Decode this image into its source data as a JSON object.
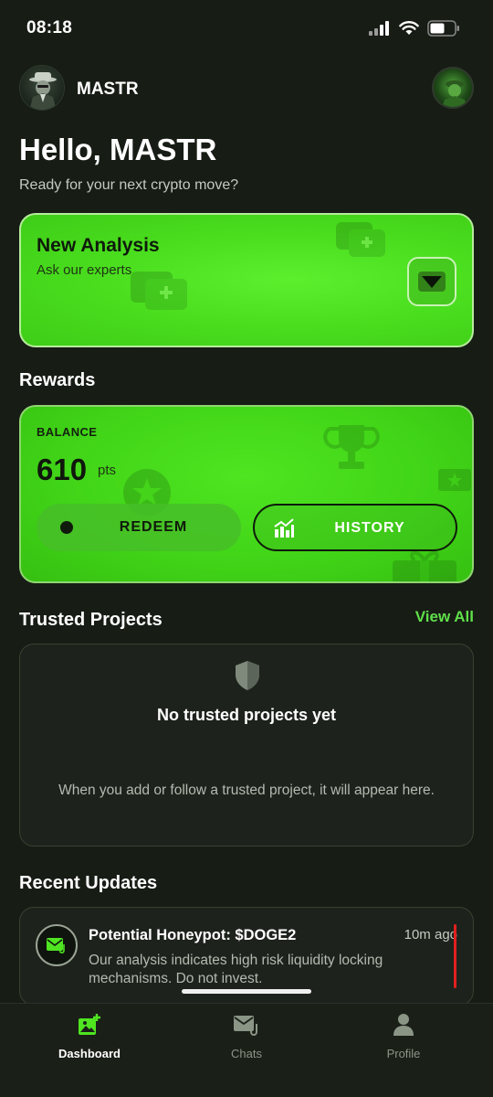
{
  "status_bar": {
    "time": "08:18"
  },
  "header": {
    "app_name": "MASTR"
  },
  "greeting": {
    "title": "Hello, MASTR",
    "subtitle": "Ready for your next crypto move?"
  },
  "analysis": {
    "title": "New Analysis",
    "subtitle": "Ask our experts"
  },
  "rewards": {
    "section_title": "Rewards",
    "balance_label": "BALANCE",
    "balance_value": "610",
    "balance_unit": "pts",
    "redeem_label": "REDEEM",
    "history_label": "HISTORY"
  },
  "trusted": {
    "section_title": "Trusted Projects",
    "view_all": "View All",
    "empty_title": "No trusted projects yet",
    "empty_desc": "When you add or follow a trusted project, it will appear here."
  },
  "updates": {
    "section_title": "Recent Updates",
    "items": [
      {
        "title": "Potential Honeypot: $DOGE2",
        "time": "10m ago",
        "desc": "Our analysis indicates high risk liquidity locking mechanisms. Do not invest."
      }
    ]
  },
  "tabbar": {
    "tabs": [
      {
        "label": "Dashboard",
        "icon": "image-add-icon",
        "active": true
      },
      {
        "label": "Chats",
        "icon": "mail-attachment-icon",
        "active": false
      },
      {
        "label": "Profile",
        "icon": "person-icon",
        "active": false
      }
    ]
  },
  "colors": {
    "accent": "#4fe521",
    "view_all": "#5fe04a",
    "alert": "#e0201e",
    "background": "#171c15"
  }
}
